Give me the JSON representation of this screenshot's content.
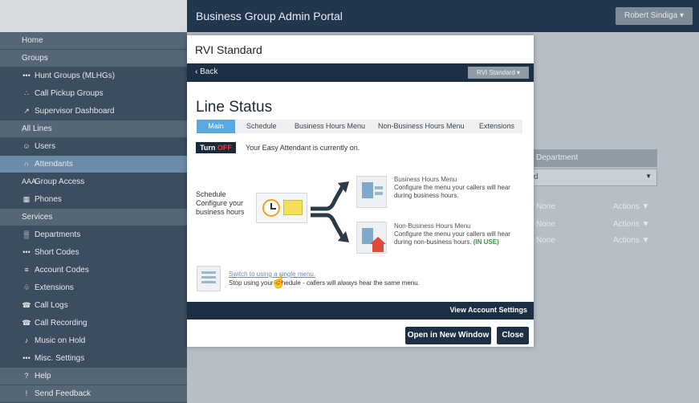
{
  "header": {
    "title": "Business Group Admin Portal",
    "user_label": "Robert Sindiga ▾"
  },
  "sidebar": {
    "items": [
      {
        "label": "Home",
        "icon": "",
        "section": true
      },
      {
        "label": "Groups",
        "icon": "",
        "section": true
      },
      {
        "label": "Hunt Groups (MLHGs)",
        "icon": "•••"
      },
      {
        "label": "Call Pickup Groups",
        "icon": "∴"
      },
      {
        "label": "Supervisor Dashboard",
        "icon": "↗"
      },
      {
        "label": "All Lines",
        "icon": "",
        "section": true
      },
      {
        "label": "Users",
        "icon": "☺"
      },
      {
        "label": "Attendants",
        "icon": "∩",
        "active": true
      },
      {
        "label": "Group Access",
        "icon": "AAA"
      },
      {
        "label": "Phones",
        "icon": "▦"
      },
      {
        "label": "Services",
        "icon": "",
        "section": true
      },
      {
        "label": "Departments",
        "icon": "▒"
      },
      {
        "label": "Short Codes",
        "icon": "•••"
      },
      {
        "label": "Account Codes",
        "icon": "≡"
      },
      {
        "label": "Extensions",
        "icon": "♧"
      },
      {
        "label": "Call Logs",
        "icon": "☎"
      },
      {
        "label": "Call Recording",
        "icon": "☎"
      },
      {
        "label": "Music on Hold",
        "icon": "♪"
      },
      {
        "label": "Misc. Settings",
        "icon": "•••"
      },
      {
        "label": "Help",
        "icon": "?",
        "section": true
      },
      {
        "label": "Send Feedback",
        "icon": "!",
        "section": true
      }
    ]
  },
  "background": {
    "dept_header": "Department",
    "select_value": "d",
    "rows": [
      {
        "name": "None",
        "action": "Actions ▼"
      },
      {
        "name": "None",
        "action": "Actions ▼"
      },
      {
        "name": "None",
        "action": "Actions ▼"
      }
    ]
  },
  "modal": {
    "title": "RVI Standard",
    "back_label": "‹ Back",
    "dropdown_label": "RVI Standard ▾",
    "heading": "Line Status",
    "tabs": [
      "Main",
      "Schedule",
      "Business Hours Menu",
      "Non-Business Hours Menu",
      "Extensions"
    ],
    "toggle_prefix": "Turn ",
    "toggle_state": "OFF",
    "toggle_text": "Your Easy Attendant is currently on.",
    "schedule_label_1": "Schedule",
    "schedule_label_2": "Configure your",
    "schedule_label_3": "business hours",
    "business_menu": {
      "title": "Business Hours Menu",
      "line1": "Configure the menu your callers will hear",
      "line2": "during business hours."
    },
    "non_business_menu": {
      "title": "Non-Business Hours Menu",
      "line1": "Configure the menu your callers will hear",
      "line2": "during non-business hours.",
      "in_use": "(IN USE)"
    },
    "switch_link": "Switch to using a single menu.",
    "switch_desc": "Stop using your schedule - callers will always hear the same menu.",
    "view_account": "View Account Settings",
    "open_new_window": "Open in New Window",
    "close": "Close"
  },
  "colors": {
    "nav_dark": "#1c2f44",
    "sidebar": "#3b4d5f",
    "accent_tab": "#5aa8e0",
    "in_use": "#2a9a3a",
    "off": "#e83b3b"
  }
}
